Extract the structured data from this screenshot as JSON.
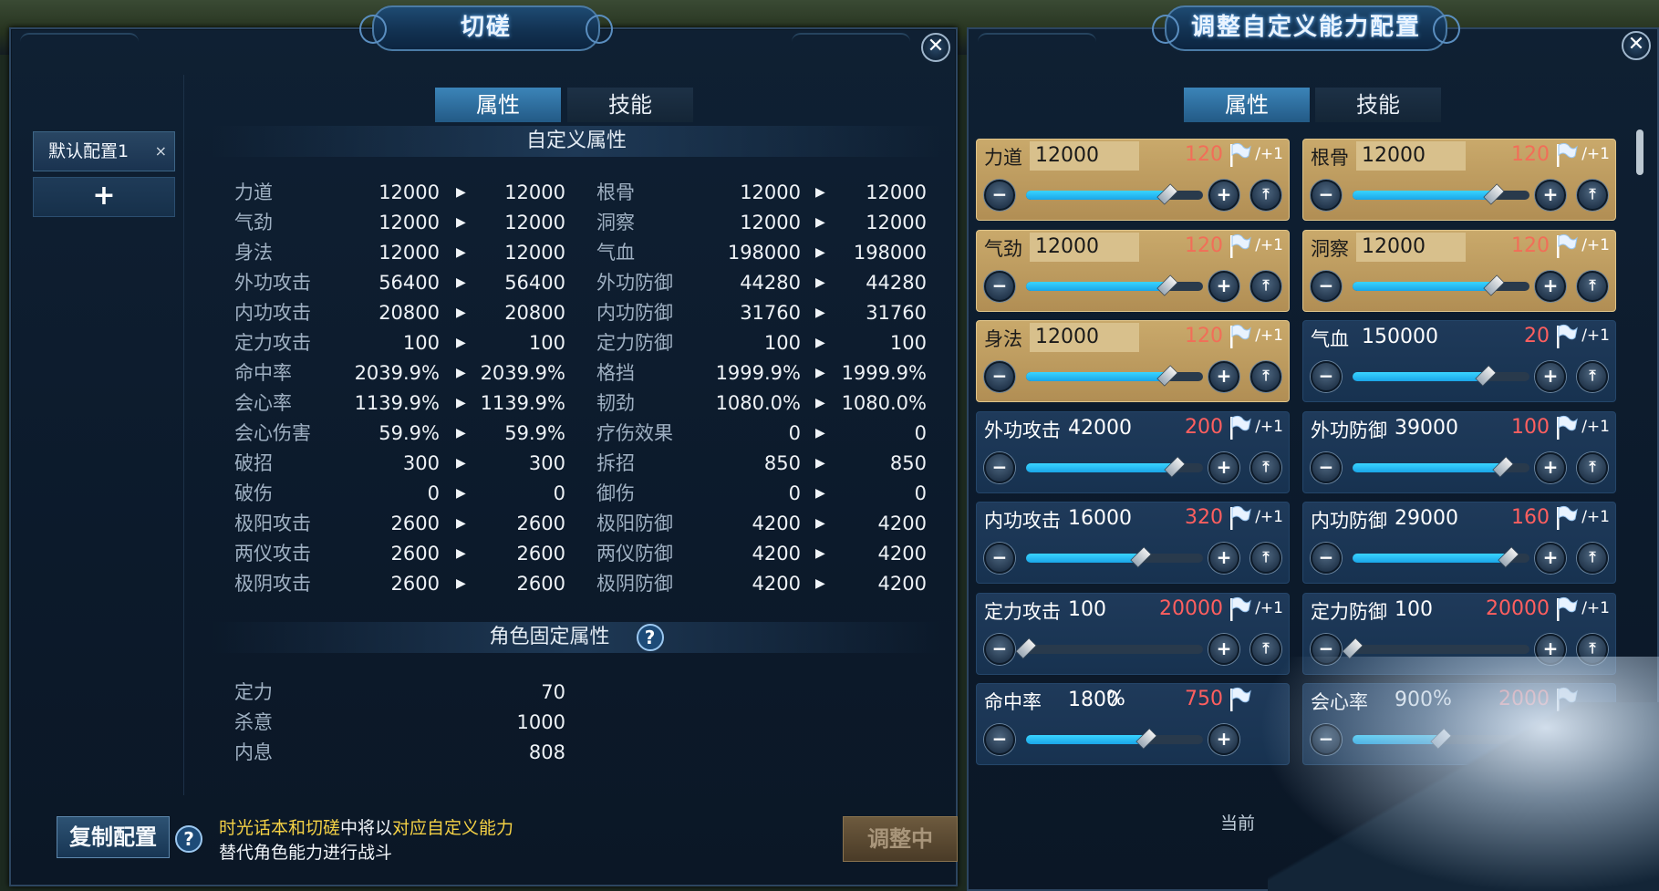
{
  "left_window": {
    "title": "切磋",
    "close_label": "✕",
    "config_items": [
      {
        "label": "默认配置1",
        "close": "×"
      }
    ],
    "add_label": "+",
    "tabs": [
      {
        "label": "属性",
        "active": true
      },
      {
        "label": "技能",
        "active": false
      }
    ],
    "custom_section_title": "自定义属性",
    "attributes_left": [
      {
        "name": "力道",
        "current": "12000",
        "new": "12000"
      },
      {
        "name": "气劲",
        "current": "12000",
        "new": "12000"
      },
      {
        "name": "身法",
        "current": "12000",
        "new": "12000"
      },
      {
        "name": "外功攻击",
        "current": "56400",
        "new": "56400"
      },
      {
        "name": "内功攻击",
        "current": "20800",
        "new": "20800"
      },
      {
        "name": "定力攻击",
        "current": "100",
        "new": "100"
      },
      {
        "name": "命中率",
        "current": "2039.9%",
        "new": "2039.9%"
      },
      {
        "name": "会心率",
        "current": "1139.9%",
        "new": "1139.9%"
      },
      {
        "name": "会心伤害",
        "current": "59.9%",
        "new": "59.9%"
      },
      {
        "name": "破招",
        "current": "300",
        "new": "300"
      },
      {
        "name": "破伤",
        "current": "0",
        "new": "0"
      },
      {
        "name": "极阳攻击",
        "current": "2600",
        "new": "2600"
      },
      {
        "name": "两仪攻击",
        "current": "2600",
        "new": "2600"
      },
      {
        "name": "极阴攻击",
        "current": "2600",
        "new": "2600"
      }
    ],
    "attributes_right": [
      {
        "name": "根骨",
        "current": "12000",
        "new": "12000"
      },
      {
        "name": "洞察",
        "current": "12000",
        "new": "12000"
      },
      {
        "name": "气血",
        "current": "198000",
        "new": "198000"
      },
      {
        "name": "外功防御",
        "current": "44280",
        "new": "44280"
      },
      {
        "name": "内功防御",
        "current": "31760",
        "new": "31760"
      },
      {
        "name": "定力防御",
        "current": "100",
        "new": "100"
      },
      {
        "name": "格挡",
        "current": "1999.9%",
        "new": "1999.9%"
      },
      {
        "name": "韧劲",
        "current": "1080.0%",
        "new": "1080.0%"
      },
      {
        "name": "疗伤效果",
        "current": "0",
        "new": "0"
      },
      {
        "name": "拆招",
        "current": "850",
        "new": "850"
      },
      {
        "name": "御伤",
        "current": "0",
        "new": "0"
      },
      {
        "name": "极阳防御",
        "current": "4200",
        "new": "4200"
      },
      {
        "name": "两仪防御",
        "current": "4200",
        "new": "4200"
      },
      {
        "name": "极阴防御",
        "current": "4200",
        "new": "4200"
      }
    ],
    "fixed_section_title": "角色固定属性",
    "help_label": "?",
    "fixed_attributes": [
      {
        "name": "定力",
        "value": "70"
      },
      {
        "name": "杀意",
        "value": "1000"
      },
      {
        "name": "内息",
        "value": "808"
      }
    ],
    "copy_button": "复制配置",
    "hint_parts": [
      {
        "text": "时光话本和切磋",
        "color": "yellow"
      },
      {
        "text": "中将以",
        "color": "white"
      },
      {
        "text": "对应自定义能力",
        "color": "yellow"
      },
      {
        "text": "替代角色能力进行战斗",
        "color": "white"
      }
    ],
    "adjusting_button": "调整中"
  },
  "right_window": {
    "title": "调整自定义能力配置",
    "close_label": "✕",
    "tabs": [
      {
        "label": "属性",
        "active": true
      },
      {
        "label": "技能",
        "active": false
      }
    ],
    "cards": [
      {
        "name": "力道",
        "value": "12000",
        "limit": "120",
        "step": "/+1",
        "style": "gold",
        "level": 0.8
      },
      {
        "name": "根骨",
        "value": "12000",
        "limit": "120",
        "step": "/+1",
        "style": "gold",
        "level": 0.8
      },
      {
        "name": "气劲",
        "value": "12000",
        "limit": "120",
        "step": "/+1",
        "style": "gold",
        "level": 0.8
      },
      {
        "name": "洞察",
        "value": "12000",
        "limit": "120",
        "step": "/+1",
        "style": "gold",
        "level": 0.8
      },
      {
        "name": "身法",
        "value": "12000",
        "limit": "120",
        "step": "/+1",
        "style": "gold",
        "level": 0.8
      },
      {
        "name": "气血",
        "value": "150000",
        "limit": "20",
        "step": "/+1",
        "style": "blue",
        "level": 0.75
      },
      {
        "name": "外功攻击",
        "value": "42000",
        "limit": "200",
        "step": "/+1",
        "style": "blue",
        "level": 0.84
      },
      {
        "name": "外功防御",
        "value": "39000",
        "limit": "100",
        "step": "/+1",
        "style": "blue",
        "level": 0.85
      },
      {
        "name": "内功攻击",
        "value": "16000",
        "limit": "320",
        "step": "/+1",
        "style": "blue",
        "level": 0.65
      },
      {
        "name": "内功防御",
        "value": "29000",
        "limit": "160",
        "step": "/+1",
        "style": "blue",
        "level": 0.88
      },
      {
        "name": "定力攻击",
        "value": "100",
        "limit": "20000",
        "step": "/+1",
        "style": "blue",
        "level": 0.0
      },
      {
        "name": "定力防御",
        "value": "100",
        "limit": "20000",
        "step": "/+1",
        "style": "blue",
        "level": 0.0
      },
      {
        "name": "命中率",
        "value": "1800",
        "unit": "%",
        "limit": "750",
        "step": "",
        "style": "blue",
        "level": 0.68
      },
      {
        "name": "会心率",
        "value": "900",
        "unit": "%",
        "limit": "2000",
        "step": "",
        "style": "blue",
        "level": 0.5
      }
    ],
    "current_label": "当前",
    "accent_color": "#1aa6e8",
    "limit_color": "#ff5f5f"
  }
}
